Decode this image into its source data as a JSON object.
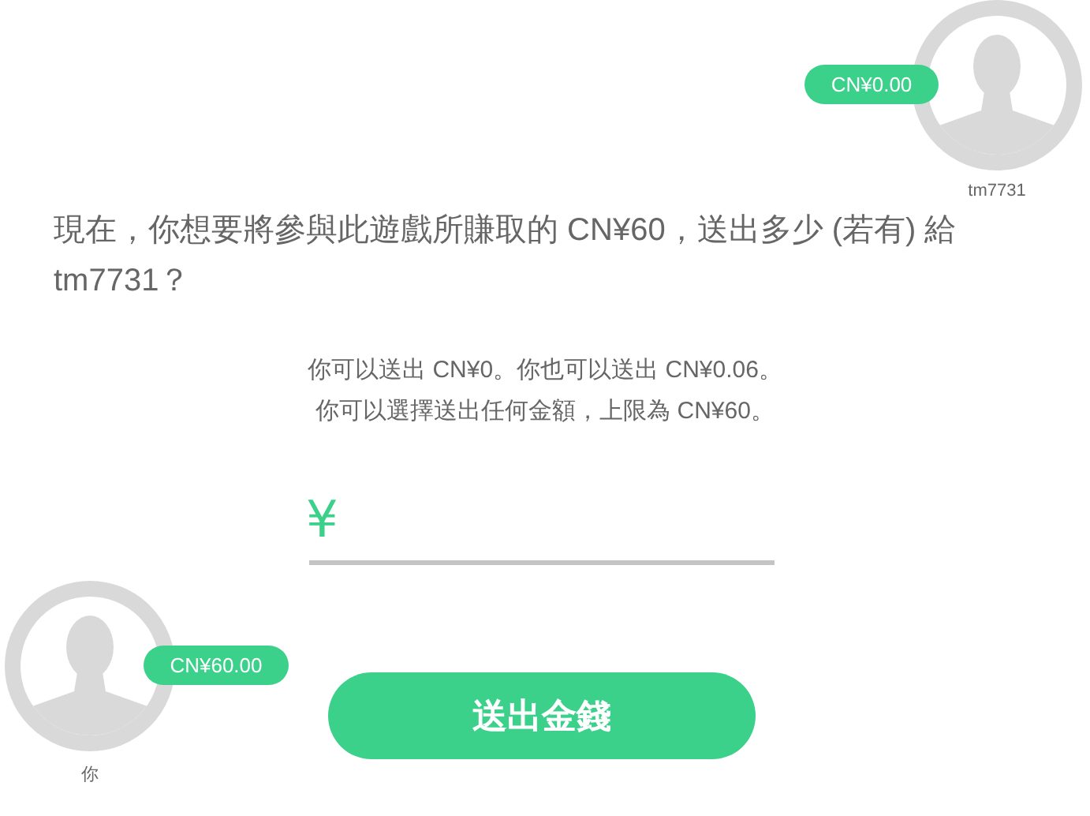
{
  "recipient": {
    "name": "tm7731",
    "balance": "CN¥0.00"
  },
  "question": "現在，你想要將參與此遊戲所賺取的 CN¥60，送出多少 (若有) 給 tm7731？",
  "info_lines": [
    "你可以送出 CN¥0。你也可以送出 CN¥0.06。",
    "你可以選擇送出任何金額，上限為 CN¥60。"
  ],
  "amount_field": {
    "currency_symbol": "¥"
  },
  "sender": {
    "name": "你",
    "balance": "CN¥60.00"
  },
  "send_button": "送出金錢"
}
